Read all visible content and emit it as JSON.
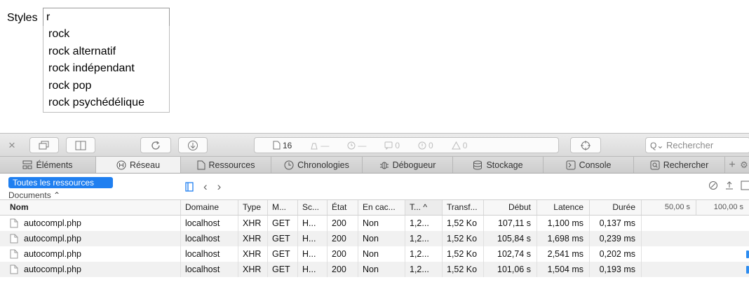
{
  "form": {
    "label": "Styles",
    "input_value": "r",
    "suggestions": [
      "rock",
      "rock alternatif",
      "rock indépendant",
      "rock pop",
      "rock psychédélique"
    ]
  },
  "toolbar": {
    "resources_count": "16",
    "load_placeholder": "—",
    "time_placeholder": "—",
    "logs_count": "0",
    "errors_count": "0",
    "warnings_count": "0",
    "search_placeholder": "Rechercher"
  },
  "tabs": [
    "Éléments",
    "Réseau",
    "Ressources",
    "Chronologies",
    "Débogueur",
    "Stockage",
    "Console",
    "Rechercher"
  ],
  "filter": {
    "all_resources": "Toutes les ressources",
    "documents": "Documents ⌃"
  },
  "table": {
    "headers": [
      "Nom",
      "Domaine",
      "Type",
      "M...",
      "Sc...",
      "État",
      "En cac...",
      "T... ^",
      "Transf...",
      "Début",
      "Latence",
      "Durée",
      "50,00 s",
      "100,00 s"
    ],
    "rows": [
      [
        "autocompl.php",
        "localhost",
        "XHR",
        "GET",
        "H...",
        "200",
        "Non",
        "1,2...",
        "1,52 Ko",
        "107,11 s",
        "1,100 ms",
        "0,137 ms"
      ],
      [
        "autocompl.php",
        "localhost",
        "XHR",
        "GET",
        "H...",
        "200",
        "Non",
        "1,2...",
        "1,52 Ko",
        "105,84 s",
        "1,698 ms",
        "0,239 ms"
      ],
      [
        "autocompl.php",
        "localhost",
        "XHR",
        "GET",
        "H...",
        "200",
        "Non",
        "1,2...",
        "1,52 Ko",
        "102,74 s",
        "2,541 ms",
        "0,202 ms"
      ],
      [
        "autocompl.php",
        "localhost",
        "XHR",
        "GET",
        "H...",
        "200",
        "Non",
        "1,2...",
        "1,52 Ko",
        "101,06 s",
        "1,504 ms",
        "0,193 ms"
      ]
    ]
  },
  "colors": {
    "accent": "#1f7ff0",
    "waterfall_bar": "#2c8cf0"
  }
}
